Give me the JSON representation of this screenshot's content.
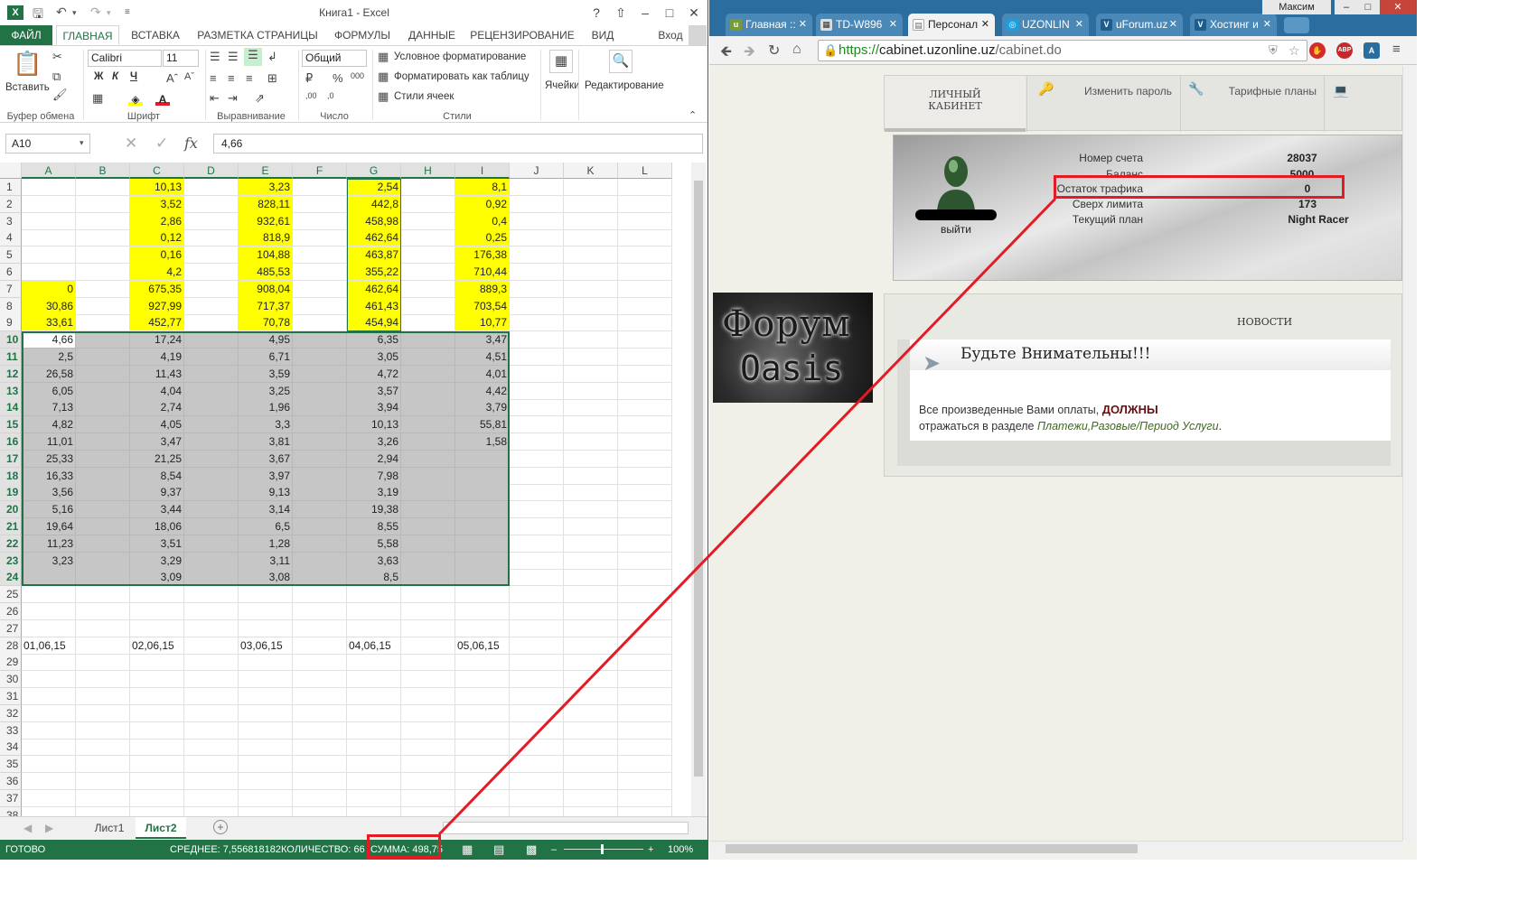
{
  "excel": {
    "title": "Книга1 - Excel",
    "ribbon_tabs": [
      "ФАЙЛ",
      "ГЛАВНАЯ",
      "ВСТАВКА",
      "РАЗМЕТКА СТРАНИЦЫ",
      "ФОРМУЛЫ",
      "ДАННЫЕ",
      "РЕЦЕНЗИРОВАНИЕ",
      "ВИД"
    ],
    "active_tab": "ГЛАВНАЯ",
    "signin": "Вход",
    "help": "?",
    "ribbon": {
      "paste": "Вставить",
      "font_name": "Calibri",
      "font_size": "11",
      "number_format": "Общий",
      "cond_format": "Условное форматирование",
      "format_table": "Форматировать как таблицу",
      "cell_styles": "Стили ячеек",
      "cells": "Ячейки",
      "editing": "Редактирование",
      "groups": [
        "Буфер обмена",
        "Шрифт",
        "Выравнивание",
        "Число",
        "Стили"
      ],
      "bold": "Ж",
      "italic": "К",
      "underline": "Ч"
    },
    "name_box": "A10",
    "formula": "4,66",
    "fx": "fx",
    "columns": [
      "A",
      "B",
      "C",
      "D",
      "E",
      "F",
      "G",
      "H",
      "I",
      "J",
      "K",
      "L"
    ],
    "rows": [
      "1",
      "2",
      "3",
      "4",
      "5",
      "6",
      "7",
      "8",
      "9",
      "10",
      "11",
      "12",
      "13",
      "14",
      "15",
      "16",
      "17",
      "18",
      "19",
      "20",
      "21",
      "22",
      "23",
      "24",
      "25",
      "26",
      "27",
      "28",
      "29",
      "30",
      "31",
      "32",
      "33",
      "34",
      "35",
      "36",
      "37",
      "38"
    ],
    "cells": {
      "A": [
        "",
        "",
        "",
        "",
        "",
        "",
        "0",
        "30,86",
        "33,61",
        "4,66",
        "2,5",
        "26,58",
        "6,05",
        "7,13",
        "4,82",
        "11,01",
        "25,33",
        "16,33",
        "3,56",
        "5,16",
        "19,64",
        "11,23",
        "3,23",
        "",
        "",
        "",
        "",
        ""
      ],
      "C": [
        "10,13",
        "3,52",
        "2,86",
        "0,12",
        "0,16",
        "4,2",
        "675,35",
        "927,99",
        "452,77",
        "17,24",
        "4,19",
        "11,43",
        "4,04",
        "2,74",
        "4,05",
        "3,47",
        "21,25",
        "8,54",
        "9,37",
        "3,44",
        "18,06",
        "3,51",
        "3,29",
        "3,09",
        "",
        "",
        "",
        ""
      ],
      "E": [
        "3,23",
        "828,11",
        "932,61",
        "818,9",
        "104,88",
        "485,53",
        "908,04",
        "717,37",
        "70,78",
        "4,95",
        "6,71",
        "3,59",
        "3,25",
        "1,96",
        "3,3",
        "3,81",
        "3,67",
        "3,97",
        "9,13",
        "3,14",
        "6,5",
        "1,28",
        "3,11",
        "3,08",
        "",
        "",
        "",
        ""
      ],
      "G": [
        "2,54",
        "442,8",
        "458,98",
        "462,64",
        "463,87",
        "355,22",
        "462,64",
        "461,43",
        "454,94",
        "6,35",
        "3,05",
        "4,72",
        "3,57",
        "3,94",
        "10,13",
        "3,26",
        "2,94",
        "7,98",
        "3,19",
        "19,38",
        "8,55",
        "5,58",
        "3,63",
        "8,5",
        "",
        "",
        "",
        ""
      ],
      "I": [
        "8,1",
        "0,92",
        "0,4",
        "0,25",
        "176,38",
        "710,44",
        "889,3",
        "703,54",
        "10,77",
        "3,47",
        "4,51",
        "4,01",
        "4,42",
        "3,79",
        "55,81",
        "1,58",
        "",
        "",
        "",
        "",
        "",
        "",
        "",
        "",
        "",
        "",
        "",
        ""
      ]
    },
    "dates": {
      "A": "01,06,15",
      "C": "02,06,15",
      "E": "03,06,15",
      "G": "04,06,15",
      "I": "05,06,15"
    },
    "sheets": [
      "Лист1",
      "Лист2"
    ],
    "active_sheet": "Лист2",
    "status": {
      "ready": "ГОТОВО",
      "average": "СРЕДНЕЕ: 7,556818182",
      "count": "КОЛИЧЕСТВО: 66",
      "sum": "СУММА: 498,75",
      "zoom": "100%"
    },
    "colors": {
      "accent": "#217346",
      "yellow": "#ffff00",
      "selection": "#c6c6c6"
    }
  },
  "browser": {
    "user": "Максим",
    "tabs": [
      {
        "label": "Главная ::",
        "active": false
      },
      {
        "label": "TD-W896",
        "active": false
      },
      {
        "label": "Персонал",
        "active": true
      },
      {
        "label": "UZONLIN",
        "active": false
      },
      {
        "label": "uForum.uz",
        "active": false
      },
      {
        "label": "Хостинг и",
        "active": false
      }
    ],
    "url_scheme": "https://",
    "url_host": "cabinet.uzonline.uz",
    "url_path": "/cabinet.do",
    "page": {
      "tab_cabinet": "ЛИЧНЫЙ КАБИНЕТ",
      "tab_password": "Изменить пароль",
      "tab_plans": "Тарифные планы",
      "logout": "выйти",
      "info": [
        {
          "label": "Номер счета",
          "value": "28037"
        },
        {
          "label": "Баланс",
          "value": "5000"
        },
        {
          "label": "Остаток трафика",
          "value": "0"
        },
        {
          "label": "Сверх лимита",
          "value": "173"
        },
        {
          "label": "Текущий план",
          "value": "Night Racer"
        }
      ],
      "news_title": "НОВОСТИ",
      "news_heading": "Будьте Внимательны!!!",
      "news_text1": "Все произведенные Вами оплаты,",
      "news_bold": "ДОЛЖНЫ",
      "news_text2": "отражаться в разделе",
      "news_link": "Платежи,Разовые/Период Услуги",
      "news_end": ".",
      "forum_line1": "Форум",
      "forum_line2": "Oasis"
    },
    "colors": {
      "frame": "#2b6d9f",
      "highlight": "#e41b24",
      "url_green": "#1f8a1f"
    }
  }
}
